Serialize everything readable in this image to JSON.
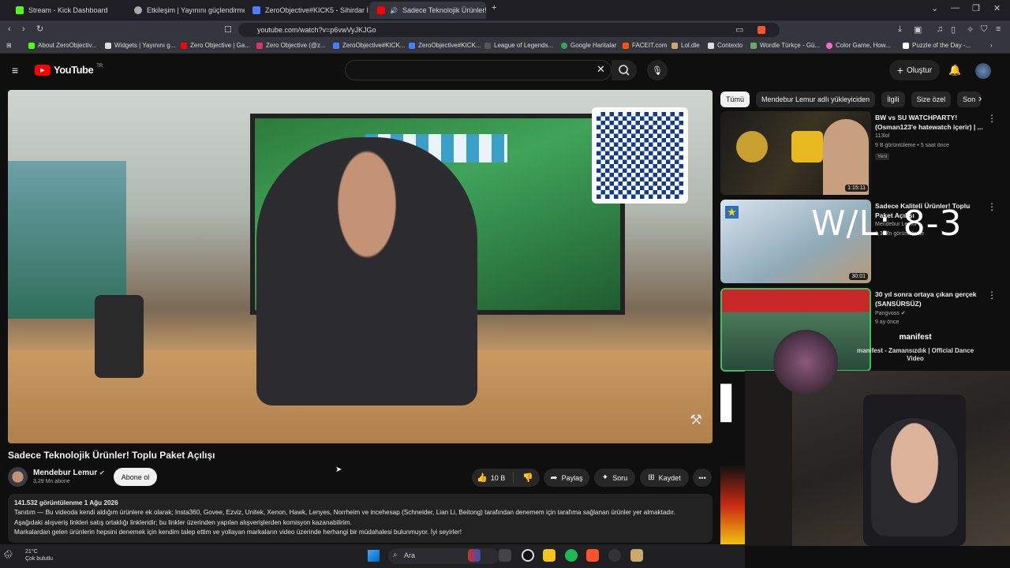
{
  "browser": {
    "tabs": [
      {
        "label": "Stream - Kick Dashboard",
        "color": "#53fc18"
      },
      {
        "label": "Etkileşim | Yayınını güçlendirmek için",
        "color": "#aaaaaa"
      },
      {
        "label": "ZeroObjective#KICK5 - Sihirdar İstatis",
        "color": "#4a7dff"
      },
      {
        "label": "Sadece Teknolojik Ürünler! To",
        "color": "#ff0000",
        "active": true
      }
    ],
    "url": "youtube.com/watch?v=p6vwVyJKJGo",
    "bookmarks": [
      "About ZeroObjectiv...",
      "Widgets | Yayınını g...",
      "Zero Objective | Ga...",
      "Zero Objective (@z...",
      "ZeroObjective#KICK...",
      "ZeroObjective#KICK...",
      "League of Legends...",
      "Google Haritalar",
      "FACEIT.com",
      "Lol.dle",
      "Contexto",
      "Wordle Türkçe - Gü...",
      "Color Game, How...",
      "Puzzle of the Day -..."
    ]
  },
  "youtube": {
    "logo": "YouTube",
    "logo_region": "TR",
    "create_label": "Oluştur"
  },
  "video": {
    "title": "Sadece Teknolojik Ürünler! Toplu Paket Açılışı",
    "channel": "Mendebur Lemur",
    "subscribers": "3,29 Mn abone",
    "subscribe_label": "Abone ol",
    "likes": "10 B",
    "share_label": "Paylaş",
    "ask_label": "Soru",
    "save_label": "Kaydet",
    "desc_stats": "141.532 görüntülenme  1 Ağu 2026",
    "desc_line1": "Tanıtım — Bu videoda kendi aldığım ürünlere ek olarak; Insta360, Govee, Ezviz, Unitek, Xenon, Hawk, Lenyes, Norrheim ve incehesap (Schneider, Lian Li, Beitong) tarafından denemem için tarafıma sağlanan ürünler yer almaktadır.",
    "desc_line2": "Aşağıdaki alışveriş linkleri satış ortaklığı  linkleridir; bu linkler üzerinden yapılan alışverişlerden komisyon kazanabilirim.",
    "desc_line3": "Markalardan gelen ürünlerin hepsini denemek için kendim talep ettim ve yollayan markaların video üzerinde herhangi bir müdahalesi bulunmuyor. İyi seyirler!"
  },
  "sidebar": {
    "chips": [
      "Tümü",
      "Mendebur Lemur adlı yükleyiciden",
      "İlgili",
      "Size özel",
      "Son"
    ],
    "cards": [
      {
        "title": "BW vs SU WATCHPARTY! (Osman123'e hatewatch içerir) | ...",
        "channel": "113lol",
        "meta": "9 B görüntüleme  •  5 saat önce",
        "badge": "Yeni",
        "duration": "1:15:11"
      },
      {
        "title": "Sadece Kaliteli Ürünler! Toplu Paket Açılışı",
        "channel": "Mendebur Lemur",
        "meta": "1,3 Mn görüntüleme",
        "duration": "30:01"
      },
      {
        "title": "30 yıl sonra ortaya çıkan gerçek (SANSÜRSÜZ)",
        "channel": "Pangvoss",
        "meta": "9 ay önce"
      }
    ]
  },
  "overlay": {
    "wl_text": "W/L: 8-3",
    "music_title": "manifest",
    "music_song": "manifest - Zamansızdık | Official Dance Video"
  },
  "taskbar": {
    "temp": "21°C",
    "weather": "Çok bulutlu",
    "search": "Ara"
  }
}
